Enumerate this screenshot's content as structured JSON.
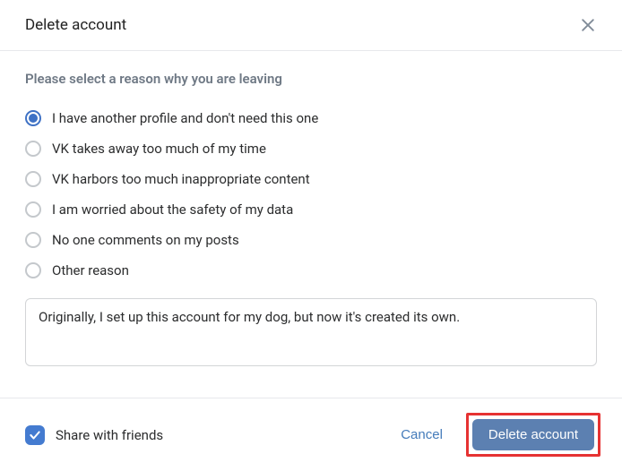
{
  "header": {
    "title": "Delete account"
  },
  "body": {
    "prompt": "Please select a reason why you are leaving",
    "reasons": [
      {
        "label": "I have another profile and don't need this one",
        "selected": true
      },
      {
        "label": "VK takes away too much of my time",
        "selected": false
      },
      {
        "label": "VK harbors too much inappropriate content",
        "selected": false
      },
      {
        "label": "I am worried about the safety of my data",
        "selected": false
      },
      {
        "label": "No one comments on my posts",
        "selected": false
      },
      {
        "label": "Other reason",
        "selected": false
      }
    ],
    "comment_value": "Originally, I set up this account for my dog, but now it's created its own."
  },
  "footer": {
    "share_label": "Share with friends",
    "share_checked": true,
    "cancel_label": "Cancel",
    "delete_label": "Delete account"
  }
}
